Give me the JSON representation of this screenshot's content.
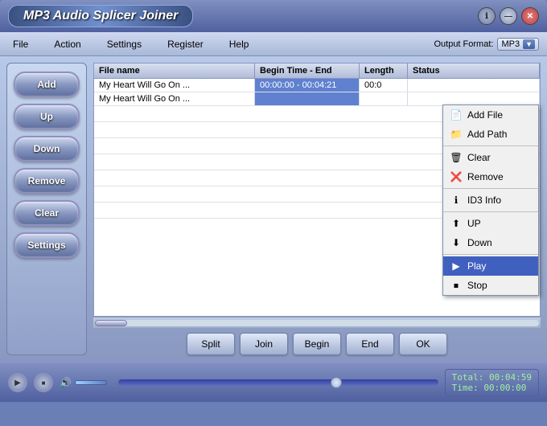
{
  "app": {
    "title": "MP3 Audio Splicer Joiner",
    "window_controls": {
      "info": "ℹ",
      "min": "—",
      "close": "✕"
    }
  },
  "menu": {
    "items": [
      "File",
      "Action",
      "Settings",
      "Register",
      "Help"
    ],
    "output_format_label": "Output Format:",
    "output_format_value": "MP3"
  },
  "side_buttons": [
    "Add",
    "Up",
    "Down",
    "Remove",
    "Clear",
    "Settings"
  ],
  "table": {
    "headers": [
      "File name",
      "Begin Time - End",
      "Length",
      "Status"
    ],
    "rows": [
      {
        "filename": "My Heart Will Go On ...",
        "begin_end": "00:00:00 - 00:04:21",
        "length": "00:0",
        "status": ""
      },
      {
        "filename": "My Heart Will Go On ...",
        "begin_end": "",
        "length": "",
        "status": ""
      }
    ]
  },
  "action_buttons": [
    "Split",
    "Join",
    "Begin",
    "End",
    "OK"
  ],
  "context_menu": {
    "items": [
      {
        "label": "Add File",
        "icon": "📄",
        "selected": false
      },
      {
        "label": "Add Path",
        "icon": "📁",
        "selected": false
      },
      {
        "label": "Clear",
        "icon": "🗑",
        "selected": false
      },
      {
        "label": "Remove",
        "icon": "❌",
        "selected": false
      },
      {
        "label": "ID3 Info",
        "icon": "ℹ",
        "selected": false
      },
      {
        "label": "UP",
        "icon": "⬆",
        "selected": false
      },
      {
        "label": "Down",
        "icon": "⬇",
        "selected": false
      },
      {
        "label": "Play",
        "icon": "▶",
        "selected": true
      },
      {
        "label": "Stop",
        "icon": "⏹",
        "selected": false
      }
    ]
  },
  "player": {
    "total_label": "Total:",
    "total_value": "00:04:59",
    "time_label": "Time:",
    "time_value": "00:00:00"
  }
}
